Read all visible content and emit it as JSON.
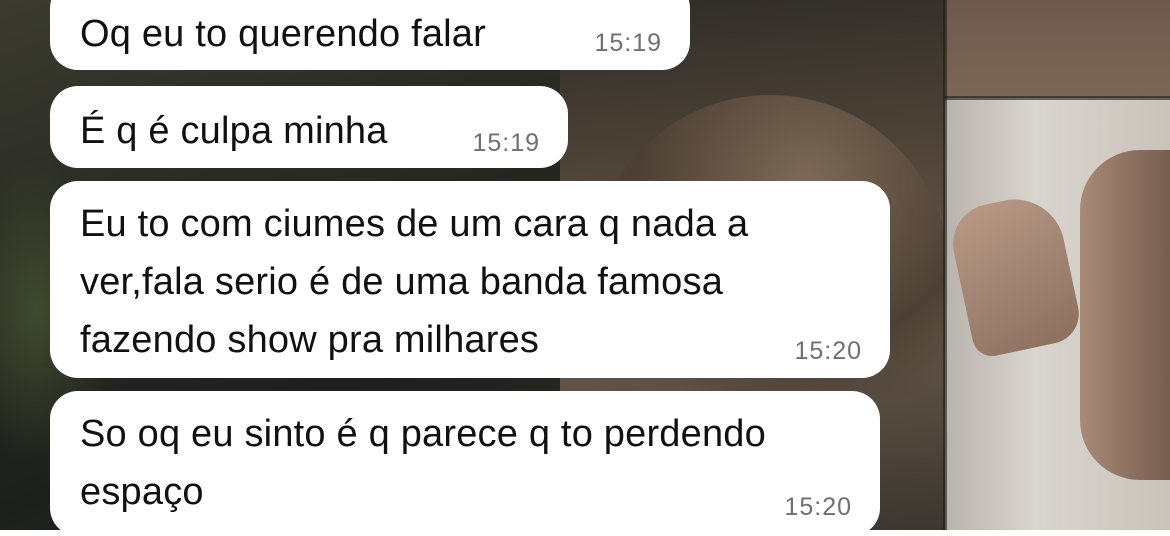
{
  "messages": [
    {
      "text": "Oq eu to querendo falar",
      "time": "15:19"
    },
    {
      "text": "É q é culpa minha",
      "time": "15:19"
    },
    {
      "text": "Eu to com ciumes de um cara q nada a\nver,fala serio é de uma banda famosa\nfazendo show pra milhares",
      "time": "15:20"
    },
    {
      "text": "So oq eu sinto é q parece q to perdendo\nespaço",
      "time": "15:20"
    }
  ],
  "theme": {
    "bubble_color": "#ffffff",
    "text_color": "#111111",
    "timestamp_color": "#6f6f73"
  }
}
